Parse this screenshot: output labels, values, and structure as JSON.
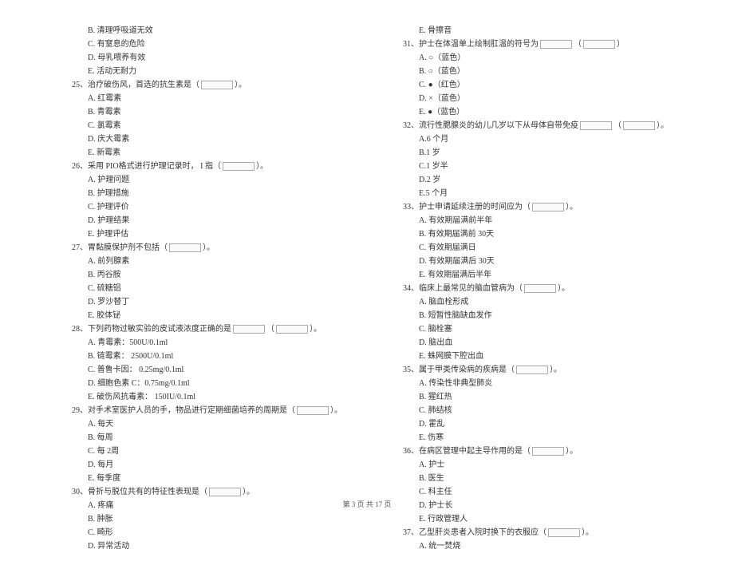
{
  "left_column": [
    {
      "type": "option",
      "label": "B.",
      "text": "清理呼吸道无效"
    },
    {
      "type": "option",
      "label": "C.",
      "text": "有窒息的危险"
    },
    {
      "type": "option",
      "label": "D.",
      "text": "母乳喂养有效"
    },
    {
      "type": "option",
      "label": "E.",
      "text": "活动无耐力"
    },
    {
      "type": "question",
      "num": "25、",
      "text_a": "治疗破伤风，首选的抗生素是（",
      "text_b": "）。"
    },
    {
      "type": "option",
      "label": "A.",
      "text": "红霉素"
    },
    {
      "type": "option",
      "label": "B.",
      "text": "青霉素"
    },
    {
      "type": "option",
      "label": "C.",
      "text": "氯霉素"
    },
    {
      "type": "option",
      "label": "D.",
      "text": "庆大霉素"
    },
    {
      "type": "option",
      "label": "E.",
      "text": "新霉素"
    },
    {
      "type": "question",
      "num": "26、",
      "text_a": "采用 PIO格式进行护理记录时，   I 指（",
      "text_b": "）。"
    },
    {
      "type": "option",
      "label": "A.",
      "text": "护理问题"
    },
    {
      "type": "option",
      "label": "B.",
      "text": "护理措施"
    },
    {
      "type": "option",
      "label": "C.",
      "text": "护理评价"
    },
    {
      "type": "option",
      "label": "D.",
      "text": "护理结果"
    },
    {
      "type": "option",
      "label": "E.",
      "text": "护理评估"
    },
    {
      "type": "question",
      "num": "27、",
      "text_a": "胃黏膜保护剂不包括（",
      "text_b": "）。"
    },
    {
      "type": "option",
      "label": "A.",
      "text": "前列腺素"
    },
    {
      "type": "option",
      "label": "B.",
      "text": "丙谷胺"
    },
    {
      "type": "option",
      "label": "C.",
      "text": "硫糖铝"
    },
    {
      "type": "option",
      "label": "D.",
      "text": "罗沙替丁"
    },
    {
      "type": "option",
      "label": "E.",
      "text": "胶体铋"
    },
    {
      "type": "question",
      "num": "28、",
      "text_a": "下列药物过敏实验的皮试液浓度正确的是",
      "text_b": "（",
      "text_c": "）",
      "text_d": "。"
    },
    {
      "type": "option",
      "label": "A.",
      "text": "青霉素：500U/0.1ml"
    },
    {
      "type": "option",
      "label": "B.",
      "text": "链霉素：   2500U/0.1ml"
    },
    {
      "type": "option",
      "label": "C.",
      "text": "普鲁卡因：    0.25mg/0.1ml"
    },
    {
      "type": "option",
      "label": "D.",
      "text": "细胞色素     C：0.75mg/0.1ml"
    },
    {
      "type": "option",
      "label": "E.",
      "text": "破伤风抗毒素：      150IU/0.1ml"
    },
    {
      "type": "question",
      "num": "29、",
      "text_a": "对手术室医护人员的手，物品进行定期细菌培养的周期是（",
      "text_b": "）。"
    },
    {
      "type": "option",
      "label": "A.",
      "text": "每天"
    },
    {
      "type": "option",
      "label": "B.",
      "text": "每周"
    },
    {
      "type": "option",
      "label": "C.",
      "text": "每 2周"
    },
    {
      "type": "option",
      "label": "D.",
      "text": "每月"
    },
    {
      "type": "option",
      "label": "E.",
      "text": "每季度"
    },
    {
      "type": "question",
      "num": "30、",
      "text_a": "骨折与脱位共有的特征性表现是（",
      "text_b": "）。"
    },
    {
      "type": "option",
      "label": "A.",
      "text": "疼痛"
    },
    {
      "type": "option",
      "label": "B.",
      "text": "肿胀"
    },
    {
      "type": "option",
      "label": "C.",
      "text": "畸形"
    },
    {
      "type": "option",
      "label": "D.",
      "text": "异常活动"
    }
  ],
  "right_column": [
    {
      "type": "option",
      "label": "E.",
      "text": "骨擦音"
    },
    {
      "type": "question",
      "num": "31、",
      "text_a": "护士在体温单上绘制肛温的符号为",
      "text_b": "（",
      "text_c": "）"
    },
    {
      "type": "option",
      "label": "A.",
      "text": "○（蓝色）"
    },
    {
      "type": "option",
      "label": "B.",
      "text": "○（蓝色）"
    },
    {
      "type": "option",
      "label": "C.",
      "text": "●（红色）"
    },
    {
      "type": "option",
      "label": "D.",
      "text": "×（蓝色）"
    },
    {
      "type": "option",
      "label": "E.",
      "text": "●（蓝色）"
    },
    {
      "type": "question",
      "num": "32、",
      "text_a": "流行性腮腺炎的幼儿几岁以下从母体自带免疫",
      "text_b": "（",
      "text_c": "）",
      "text_d": "。"
    },
    {
      "type": "option",
      "label": "",
      "text": "A.6 个月"
    },
    {
      "type": "option",
      "label": "",
      "text": "B.1 岁"
    },
    {
      "type": "option",
      "label": "",
      "text": "C.1 岁半"
    },
    {
      "type": "option",
      "label": "",
      "text": "D.2 岁"
    },
    {
      "type": "option",
      "label": "",
      "text": "E.5 个月"
    },
    {
      "type": "question",
      "num": "33、",
      "text_a": "护士申请延续注册的时间应为（",
      "text_b": "）。"
    },
    {
      "type": "option",
      "label": "A.",
      "text": "有效期届满前半年"
    },
    {
      "type": "option",
      "label": "B.",
      "text": "有效期届满前    30天"
    },
    {
      "type": "option",
      "label": "C.",
      "text": "有效期届满日"
    },
    {
      "type": "option",
      "label": "D.",
      "text": "有效期届满后    30天"
    },
    {
      "type": "option",
      "label": "E.",
      "text": "有效期届满后半年"
    },
    {
      "type": "question",
      "num": "34、",
      "text_a": "临床上最常见的脑血管病为（",
      "text_b": "）。"
    },
    {
      "type": "option",
      "label": "A.",
      "text": "脑血栓形成"
    },
    {
      "type": "option",
      "label": "B.",
      "text": "短暂性脑缺血发作"
    },
    {
      "type": "option",
      "label": "C.",
      "text": "脑栓塞"
    },
    {
      "type": "option",
      "label": "D.",
      "text": "脑出血"
    },
    {
      "type": "option",
      "label": "E.",
      "text": "蛛网膜下腔出血"
    },
    {
      "type": "question",
      "num": "35、",
      "text_a": "属于甲类传染病的疾病是（",
      "text_b": "）。"
    },
    {
      "type": "option",
      "label": "A.",
      "text": "传染性非典型肺炎"
    },
    {
      "type": "option",
      "label": "B.",
      "text": "猩红热"
    },
    {
      "type": "option",
      "label": "C.",
      "text": "肺结核"
    },
    {
      "type": "option",
      "label": "D.",
      "text": "霍乱"
    },
    {
      "type": "option",
      "label": "E.",
      "text": "伤寒"
    },
    {
      "type": "question",
      "num": "36、",
      "text_a": "在病区管理中起主导作用的是（",
      "text_b": "）。"
    },
    {
      "type": "option",
      "label": "A.",
      "text": "护士"
    },
    {
      "type": "option",
      "label": "B.",
      "text": "医生"
    },
    {
      "type": "option",
      "label": "C.",
      "text": "科主任"
    },
    {
      "type": "option",
      "label": "D.",
      "text": "护士长"
    },
    {
      "type": "option",
      "label": "E.",
      "text": "行政管理人"
    },
    {
      "type": "question",
      "num": "37、",
      "text_a": "乙型肝炎患者入院时换下的衣服应（",
      "text_b": "）。"
    },
    {
      "type": "option",
      "label": "A.",
      "text": "统一焚烧"
    }
  ],
  "footer": "第  3 页  共  17 页"
}
